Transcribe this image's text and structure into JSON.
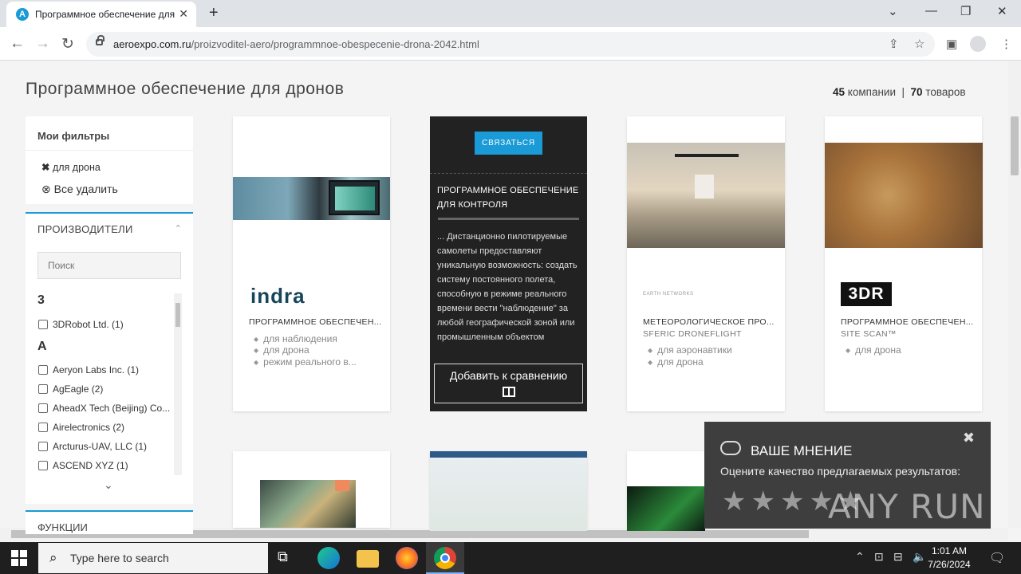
{
  "browser": {
    "tab_title": "Программное обеспечение для дронов",
    "url_host": "aeroexpo.com.ru",
    "url_path": "/proizvoditel-aero/programmnoe-obespecenie-drona-2042.html"
  },
  "page": {
    "title": "Программное обеспечение для дронов",
    "companies_count": "45",
    "companies_label": "компании",
    "products_count": "70",
    "products_label": "товаров"
  },
  "filters": {
    "heading": "Мои фильтры",
    "active_chip": "для дрона",
    "clear_all": "Все удалить"
  },
  "manufacturers": {
    "heading": "ПРОИЗВОДИТЕЛИ",
    "search_placeholder": "Поиск",
    "group1_letter": "3",
    "group1_items": [
      "3DRobot Ltd. (1)"
    ],
    "group2_letter": "A",
    "group2_items": [
      "Aeryon Labs Inc. (1)",
      "AgEagle (2)",
      "AheadX Tech (Beijing) Co...",
      "Airelectronics (2)",
      "Arcturus-UAV, LLC (1)",
      "ASCEND XYZ (1)"
    ]
  },
  "functions": {
    "heading": "ФУНКЦИИ"
  },
  "products": [
    {
      "name": "ПРОГРАММНОЕ ОБЕСПЕЧЕН...",
      "brand": "",
      "logo": "indra",
      "tags": [
        "для наблюдения",
        "для дрона",
        "режим реального в..."
      ]
    },
    {
      "name": "",
      "brand": "",
      "logo": "",
      "tags": []
    },
    {
      "name": "МЕТЕОРОЛОГИЧЕСКОЕ ПРО...",
      "brand": "SFERIC DRONEFLIGHT",
      "logo": "EARTH NETWORKS",
      "tags": [
        "для аэронавтики",
        "для дрона"
      ]
    },
    {
      "name": "ПРОГРАММНОЕ ОБЕСПЕЧЕН...",
      "brand": "SITE SCAN™",
      "logo": "3DR",
      "tags": [
        "для дрона"
      ]
    }
  ],
  "overlay": {
    "contact_button": "СВЯЗАТЬСЯ",
    "title": "ПРОГРАММНОЕ ОБЕСПЕЧЕНИЕ ДЛЯ КОНТРОЛЯ",
    "description": "... Дистанционно пилотируемые самолеты предоставляют уникальную возможность: создать систему постоянного полета, способную в режиме реального времени вести \"наблюдение\" за любой географической зоной или промышленным объектом",
    "compare_button": "Добавить к сравнению"
  },
  "feedback": {
    "title": "ВАШЕ МНЕНИЕ",
    "question": "Оцените качество предлагаемых результатов:",
    "stars": 5,
    "watermark": "ANY RUN"
  },
  "taskbar": {
    "search_placeholder": "Type here to search",
    "time": "1:01 AM",
    "date": "7/26/2024"
  }
}
